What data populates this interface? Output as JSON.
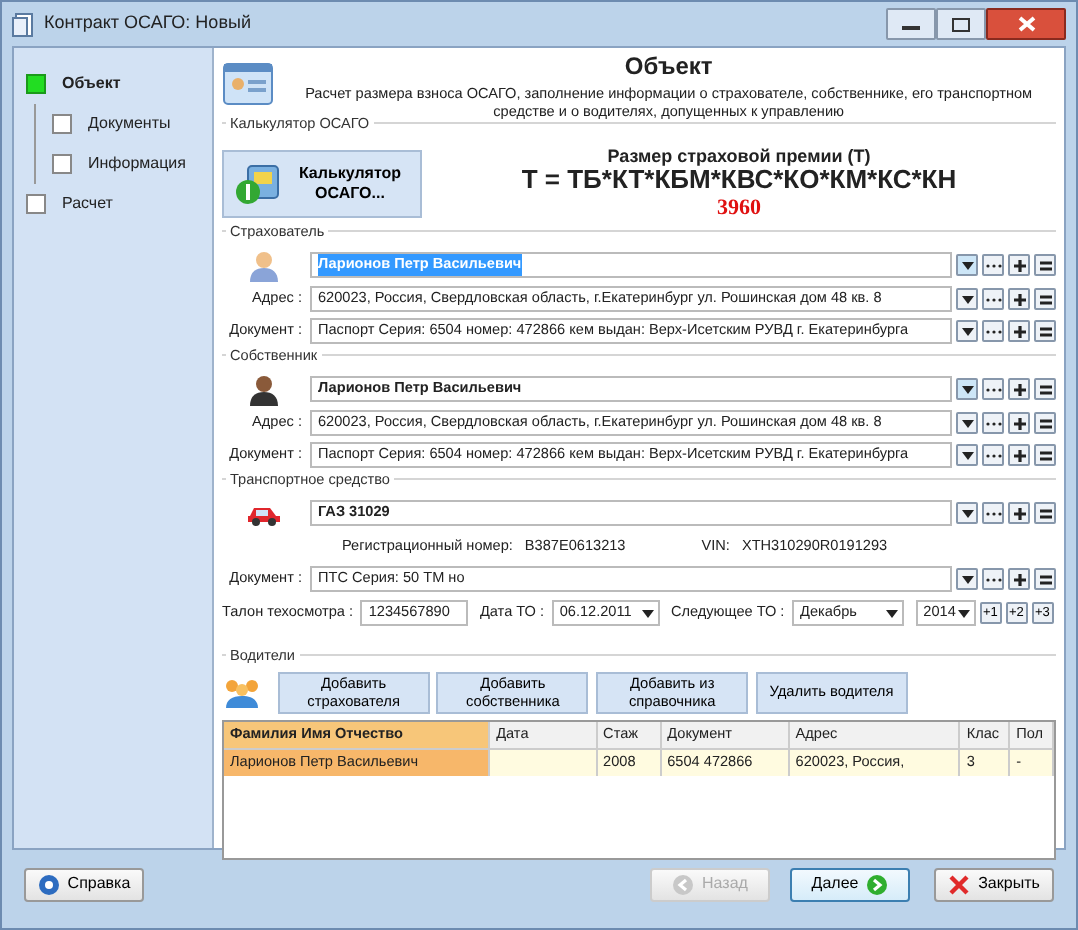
{
  "window": {
    "title": "Контракт ОСАГО: Новый"
  },
  "sidebar": {
    "steps": [
      {
        "label": "Объект",
        "selected": true,
        "children": [
          {
            "label": "Документы",
            "selected": false
          },
          {
            "label": "Информация",
            "selected": false
          }
        ]
      },
      {
        "label": "Расчет",
        "selected": false
      }
    ]
  },
  "header": {
    "title": "Объект",
    "description": "Расчет размера взноса ОСАГО, заполнение информации о страхователе, собственнике, его транспортном средстве и о водителях, допущенных к управлению"
  },
  "calculator": {
    "group_label": "Калькулятор ОСАГО",
    "button": "Калькулятор ОСАГО...",
    "premium_title": "Размер страховой премии (Т)",
    "formula": "Т = ТБ*КТ*КБМ*КВС*КО*КМ*КС*КН",
    "value": "3960"
  },
  "persons": [
    {
      "group_label": "Страхователь",
      "kind": "insurer",
      "name": "Ларионов Петр Васильевич",
      "highlighted": true,
      "address_label": "Адрес :",
      "address": "620023, Россия, Свердловская область,  г.Екатеринбург ул. Рошинская дом 48 кв. 8",
      "document_label": "Документ :",
      "document": "Паспорт Серия: 6504 номер: 472866 кем выдан: Верх-Исетским РУВД г. Екатеринбурга"
    },
    {
      "group_label": "Собственник",
      "kind": "owner",
      "name": "Ларионов Петр Васильевич",
      "highlighted": false,
      "address_label": "Адрес :",
      "address": "620023, Россия, Свердловская область,  г.Екатеринбург ул. Рошинская дом 48 кв. 8",
      "document_label": "Документ :",
      "document": "Паспорт Серия: 6504 номер: 472866 кем выдан: Верх-Исетским РУВД г. Екатеринбурга"
    }
  ],
  "vehicle": {
    "group_label": "Транспортное средство",
    "name": "ГАЗ 31029",
    "reg_label": "Регистрационный номер:",
    "reg_number": "В387Е0613213",
    "vin_label": "VIN:",
    "vin": "XTH310290R0191293",
    "document_label": "Документ :",
    "document": "ПТС Серия: 50 ТМ но",
    "talon_label": "Талон техосмотра :",
    "talon": "1234567890",
    "to_date_label": "Дата ТО :",
    "to_date": "06.12.2011",
    "next_to_label": "Следующее ТО :",
    "next_to_month": "Декабрь",
    "next_to_year": "2014",
    "year_buttons": [
      "+1",
      "+2",
      "+3"
    ]
  },
  "drivers": {
    "group_label": "Водители",
    "buttons": [
      "Добавить страхователя",
      "Добавить собственника",
      "Добавить из справочника",
      "Удалить водителя"
    ],
    "columns": [
      "Фамилия Имя Отчество",
      "Дата",
      "Стаж",
      "Документ",
      "Адрес",
      "Клас",
      "Пол"
    ],
    "rows": [
      {
        "selected": true,
        "cells": [
          "Ларионов Петр Васильевич",
          "",
          "2008",
          "6504 472866",
          "620023, Россия,",
          "3",
          "-"
        ]
      }
    ]
  },
  "footer": {
    "help": "Справка",
    "back": {
      "label": "Назад",
      "disabled": true
    },
    "next": {
      "label": "Далее",
      "disabled": false
    },
    "close": "Закрыть"
  }
}
